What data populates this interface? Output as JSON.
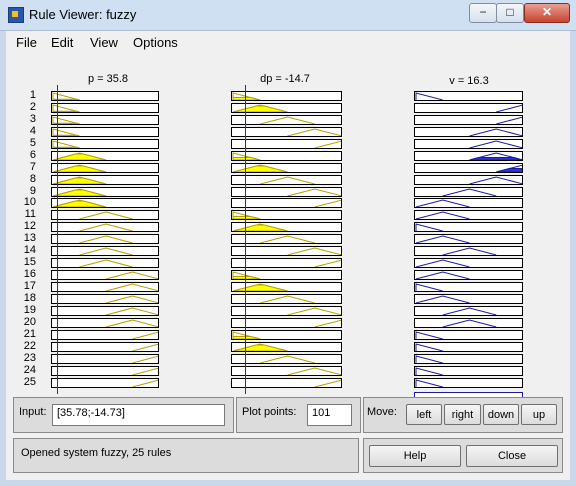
{
  "window": {
    "title": "Rule Viewer: fuzzy",
    "min_glyph": "−",
    "max_glyph": "□",
    "close_glyph": "✕"
  },
  "menu": [
    "File",
    "Edit",
    "View",
    "Options"
  ],
  "plot": {
    "headers": {
      "input1": "p = 35.8",
      "input2": "dp = -14.7",
      "output": "v = 16.3"
    },
    "rule_numbers": [
      "1",
      "2",
      "3",
      "4",
      "5",
      "6",
      "7",
      "8",
      "9",
      "10",
      "11",
      "12",
      "13",
      "14",
      "15",
      "16",
      "17",
      "18",
      "19",
      "20",
      "21",
      "22",
      "23",
      "24",
      "25"
    ],
    "input1_mf_index": [
      1,
      1,
      1,
      1,
      1,
      2,
      2,
      2,
      2,
      2,
      3,
      3,
      3,
      3,
      3,
      4,
      4,
      4,
      4,
      4,
      5,
      5,
      5,
      5,
      5
    ],
    "input2_mf_index": [
      1,
      2,
      3,
      4,
      5,
      1,
      2,
      3,
      4,
      5,
      1,
      2,
      3,
      4,
      5,
      1,
      2,
      3,
      4,
      5,
      1,
      2,
      3,
      4,
      5
    ],
    "output_mf_index": [
      1,
      5,
      5,
      4,
      4,
      4,
      5,
      4,
      3,
      2,
      2,
      1,
      2,
      3,
      2,
      2,
      1,
      2,
      3,
      3,
      1,
      1,
      1,
      1,
      1
    ],
    "input1_fire": [
      0.1,
      0.1,
      0.1,
      0.1,
      0.1,
      0.85,
      0.85,
      0.85,
      0.85,
      0.85,
      0,
      0,
      0,
      0,
      0,
      0,
      0,
      0,
      0,
      0,
      0,
      0,
      0,
      0,
      0
    ],
    "input2_fire": [
      0.35,
      0.85,
      0,
      0,
      0,
      0.35,
      0.85,
      0,
      0,
      0,
      0.35,
      0.85,
      0,
      0,
      0,
      0.35,
      0.85,
      0,
      0,
      0,
      0.35,
      0.85,
      0,
      0,
      0
    ],
    "output_fire": [
      0,
      0,
      0,
      0,
      0,
      0.35,
      0.5,
      0,
      0,
      0,
      0,
      0,
      0,
      0,
      0,
      0,
      0,
      0,
      0,
      0,
      0,
      0,
      0,
      0,
      0
    ],
    "input1_value_fraction": 0.06,
    "input2_value_fraction": 0.13,
    "colors": {
      "input_mf": "#b0a000",
      "input_fill": "#ffff00",
      "output_mf": "#1a1aa0",
      "output_fill": "#3030e0",
      "cursor": "#c00000"
    }
  },
  "input": {
    "label": "Input:",
    "value": "[35.78;-14.73]"
  },
  "plot_points": {
    "label": "Plot points:",
    "value": "101"
  },
  "move": {
    "label": "Move:",
    "buttons": [
      "left",
      "right",
      "down",
      "up"
    ]
  },
  "status": "Opened system fuzzy, 25 rules",
  "buttons": {
    "help": "Help",
    "close": "Close"
  }
}
